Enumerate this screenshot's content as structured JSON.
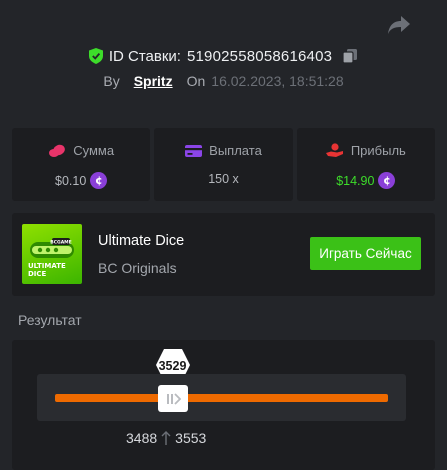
{
  "header": {
    "bet_id_label": "ID Ставки:",
    "bet_id_value": "51902558058616403"
  },
  "byline": {
    "by_label": "By",
    "username": "Spritz",
    "on_label": "On",
    "date": "16.02.2023, 18:51:28"
  },
  "stats": [
    {
      "label": "Сумма",
      "value": "$0.10",
      "icon": "coins-icon",
      "color": "#e8346a"
    },
    {
      "label": "Выплата",
      "value": "150 x",
      "icon": "wallet-icon",
      "color": "#8b45e8"
    },
    {
      "label": "Прибыль",
      "value": "$14.90",
      "icon": "hand-coins-icon",
      "color": "#e83434"
    }
  ],
  "game": {
    "name": "Ultimate Dice",
    "provider": "BC Originals",
    "thumb_text": "ULTIMATE DICE",
    "thumb_badge": "BCGAME",
    "play_label": "Играть Сейчас"
  },
  "result": {
    "title": "Результат",
    "roll": "3529",
    "range_low": "3488",
    "range_high": "3553",
    "roll_fraction": 0.3529
  },
  "colors": {
    "accent_green": "#3bc117",
    "track_orange": "#ee6a00",
    "coin_purple": "#8a3fd8",
    "shield_green": "#3ddc2a"
  }
}
